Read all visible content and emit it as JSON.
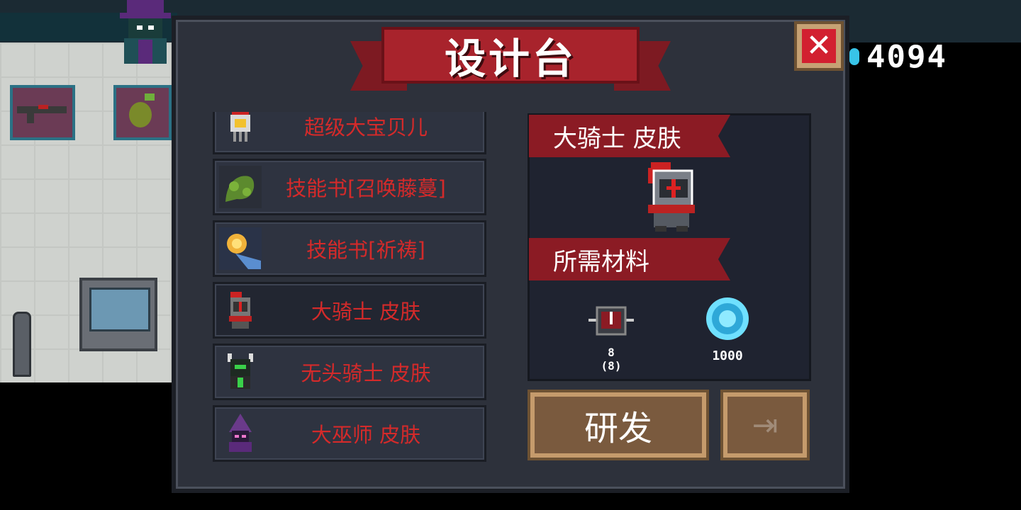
{
  "hud": {
    "currency_value": "4094",
    "currency_icon": "gem-icon"
  },
  "panel": {
    "title": "设计台",
    "close_icon": "close-icon",
    "list": [
      {
        "label": "超级大宝贝儿",
        "icon": "robot-pet-icon"
      },
      {
        "label": "技能书[召唤藤蔓]",
        "icon": "vine-icon"
      },
      {
        "label": "技能书[祈祷]",
        "icon": "pray-hand-icon"
      },
      {
        "label": "大骑士 皮肤",
        "icon": "knight-icon",
        "selected": true
      },
      {
        "label": "无头骑士 皮肤",
        "icon": "headless-knight-icon"
      },
      {
        "label": "大巫师 皮肤",
        "icon": "wizard-icon"
      }
    ],
    "detail": {
      "item_name": "大骑士 皮肤",
      "materials_heading": "所需材料",
      "materials": [
        {
          "icon": "knight-fragment-icon",
          "count": "8",
          "owned": "(8)"
        },
        {
          "icon": "gem-icon",
          "count": "1000"
        }
      ]
    },
    "research_button": "研发",
    "exit_icon": "exit-icon"
  },
  "colors": {
    "panel_bg": "#2d313b",
    "ribbon_red": "#a8232c",
    "list_text_red": "#d42a2a",
    "button_brown": "#7a5a3e",
    "gem_blue": "#38c4e8"
  }
}
